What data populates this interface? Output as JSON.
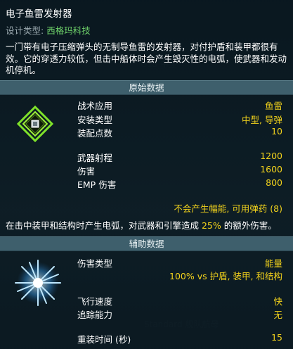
{
  "header": {
    "title": "电子鱼雷发射器",
    "design_type_label": "设计类型:",
    "design_type_value": "西格玛科技",
    "description": "一门带有电子压缩弹头的无制导鱼雷的发射器，对付护盾和装甲都很有效。它的穿透力较低，但击中船体时会产生毁灭性的电弧，使武器和发动机停机。"
  },
  "primary_section": {
    "title": "原始数据",
    "icon": "electronic-torpedo-icon",
    "rows": [
      {
        "label": "战术应用",
        "value": "鱼雷"
      },
      {
        "label": "安装类型",
        "value": "中型, 导弹"
      },
      {
        "label": "装配点数",
        "value": "10"
      },
      {
        "label": "武器射程",
        "value": "1200"
      },
      {
        "label": "伤害",
        "value": "1600"
      },
      {
        "label": "EMP 伤害",
        "value": "800"
      }
    ],
    "flux_note": "不会产生幅能, 可用弹药 (8)",
    "effect_note_prefix": "在击中装甲和结构时产生电弧，对武器和引擎造成 ",
    "effect_note_pct": "25%",
    "effect_note_suffix": " 的额外伤害。"
  },
  "secondary_section": {
    "title": "辅助数据",
    "icon": "energy-burst-icon",
    "damage_type_label": "伤害类型",
    "damage_type_value": "能量",
    "damage_modifier": "100% vs 护盾, 装甲, 和结构",
    "rows": [
      {
        "label": "飞行速度",
        "value": "快"
      },
      {
        "label": "追踪能力",
        "value": "无"
      },
      {
        "label": "重装时间 (秒)",
        "value": "15"
      }
    ]
  },
  "colors": {
    "highlight": "#f2d21c",
    "designer": "#6fd36a",
    "section_bar": "#3e5f6c",
    "icon_green": "#7fe22a",
    "icon_blue": "#5ec8ff"
  }
}
